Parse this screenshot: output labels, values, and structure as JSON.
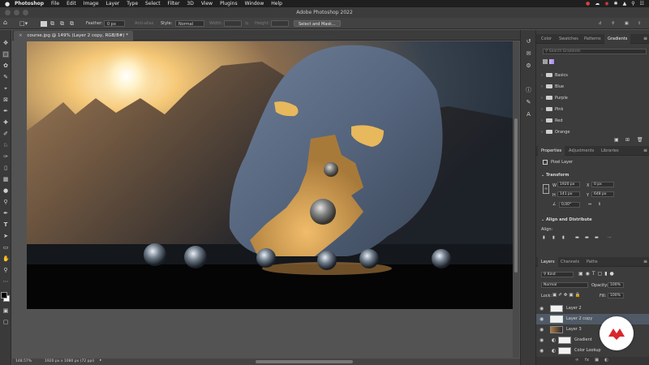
{
  "menubar": {
    "app": "Photoshop",
    "items": [
      "File",
      "Edit",
      "Image",
      "Layer",
      "Type",
      "Select",
      "Filter",
      "3D",
      "View",
      "Plugins",
      "Window",
      "Help"
    ]
  },
  "window": {
    "title": "Adobe Photoshop 2022"
  },
  "options": {
    "feather_label": "Feather:",
    "feather_value": "0 px",
    "antialias": "Anti-alias",
    "style_label": "Style:",
    "style_value": "Normal",
    "width_label": "Width:",
    "height_label": "Height:",
    "select_mask": "Select and Mask..."
  },
  "document": {
    "tab": "course.jpg @ 149% (Layer 2 copy, RGB/8#) *"
  },
  "status": {
    "zoom": "148.57%",
    "dimensions": "1920 px x 1080 px (72 ppi)"
  },
  "panels": {
    "top_tabs": [
      "Color",
      "Swatches",
      "Patterns",
      "Gradients"
    ],
    "search_placeholder": "Search Gradients",
    "gradient_folders": [
      "Basics",
      "Blue",
      "Purple",
      "Pink",
      "Red",
      "Orange"
    ],
    "props_tabs": [
      "Properties",
      "Adjustments",
      "Libraries"
    ],
    "pixel_layer": "Pixel Layer",
    "transform_label": "Transform",
    "w_label": "W",
    "w_value": "1920 px",
    "x_label": "X",
    "x_value": "0 px",
    "h_label": "H",
    "h_value": "141 px",
    "y_label": "Y",
    "y_value": "648 px",
    "angle_value": "0,00°",
    "align_label": "Align and Distribute",
    "align_sub": "Align:",
    "layers_tabs": [
      "Layers",
      "Channels",
      "Paths"
    ],
    "kind_filter": "Kind",
    "blend_mode": "Normal",
    "opacity_label": "Opacity:",
    "opacity_value": "100%",
    "lock_label": "Lock:",
    "fill_label": "Fill:",
    "fill_value": "100%",
    "layers": [
      "Layer 2",
      "Layer 2 copy",
      "Layer 3",
      "Gradient",
      "Color Lookup"
    ]
  },
  "colors": {
    "accent": "#d9262c",
    "panel": "#3c3c3c",
    "selected_layer": "#4f5a66"
  }
}
